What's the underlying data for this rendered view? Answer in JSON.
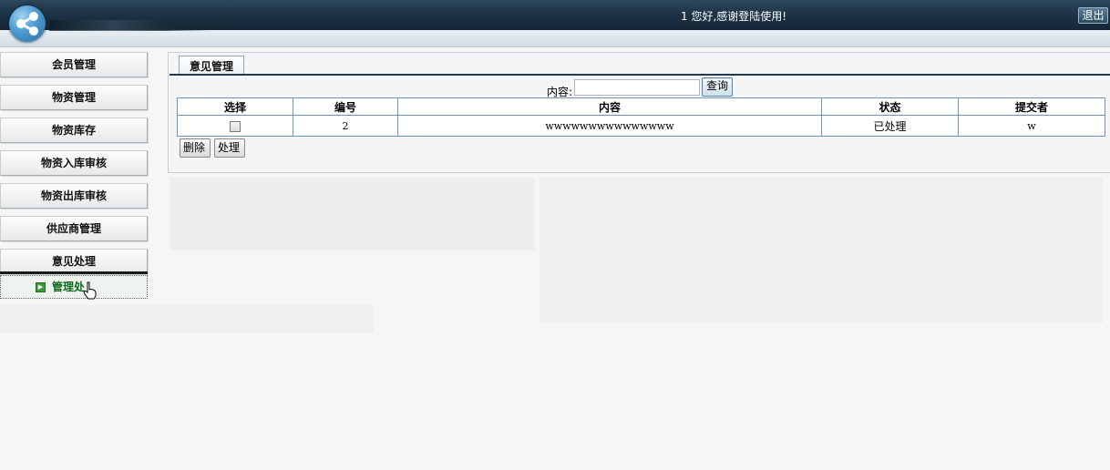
{
  "header": {
    "welcome_text": "1 您好,感谢登陆使用!",
    "logout_label": "退出"
  },
  "sidebar": {
    "items": [
      {
        "label": "会员管理"
      },
      {
        "label": "物资管理"
      },
      {
        "label": "物资库存"
      },
      {
        "label": "物资入库审核"
      },
      {
        "label": "物资出库审核"
      },
      {
        "label": "供应商管理"
      },
      {
        "label": "意见处理"
      }
    ],
    "active_sub_item": {
      "label": "管理处"
    }
  },
  "main": {
    "tab_title": "意见管理",
    "search": {
      "label": "内容:",
      "value": "",
      "button_label": "查询"
    },
    "table": {
      "headers": [
        "选择",
        "编号",
        "内容",
        "状态",
        "提交者"
      ],
      "rows": [
        {
          "selected": false,
          "id": "2",
          "content": "wwwwwwwwwwwwwww",
          "status": "已处理",
          "submitter": "w"
        }
      ]
    },
    "actions": {
      "delete_label": "删除",
      "process_label": "处理"
    }
  },
  "colors": {
    "header_bg": "#1b3143",
    "table_border": "#6f93bd",
    "active_sub_text": "#0e6a1c"
  },
  "icons": {
    "logo": "share-logo-icon",
    "sub_item": "arrow-right-icon",
    "cursor": "hand-pointer-icon"
  }
}
